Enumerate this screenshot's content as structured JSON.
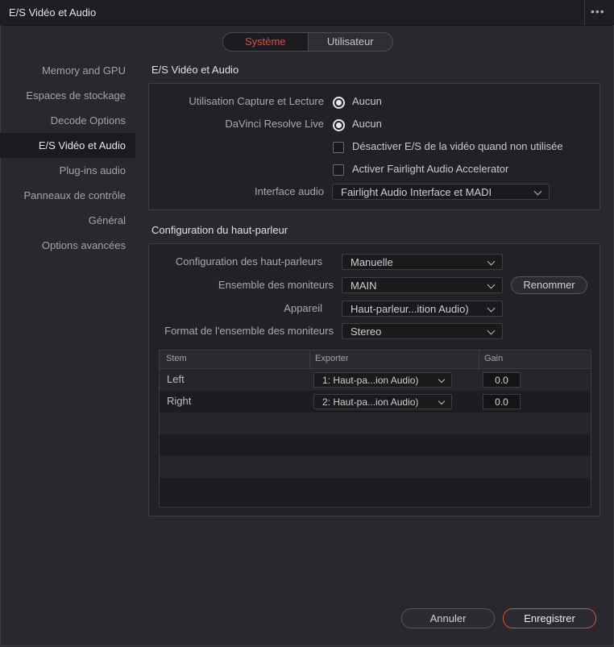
{
  "window": {
    "title": "E/S Vidéo et Audio",
    "menu_icon": "more-horizontal-icon"
  },
  "tabs": [
    {
      "label": "Système",
      "active": true
    },
    {
      "label": "Utilisateur",
      "active": false
    }
  ],
  "sidebar": {
    "items": [
      {
        "label": "Memory and GPU"
      },
      {
        "label": "Espaces de stockage"
      },
      {
        "label": "Decode Options"
      },
      {
        "label": "E/S Vidéo et Audio",
        "active": true
      },
      {
        "label": "Plug-ins audio"
      },
      {
        "label": "Panneaux de contrôle"
      },
      {
        "label": "Général"
      },
      {
        "label": "Options avancées"
      }
    ]
  },
  "io_section": {
    "title": "E/S Vidéo et Audio",
    "capture_label": "Utilisation Capture et Lecture",
    "capture_value": "Aucun",
    "live_label": "DaVinci Resolve Live",
    "live_value": "Aucun",
    "disable_io_label": "Désactiver E/S de la vidéo quand non utilisée",
    "fairlight_accel_label": "Activer Fairlight Audio Accelerator",
    "interface_label": "Interface audio",
    "interface_value": "Fairlight Audio Interface et MADI"
  },
  "speaker_section": {
    "title": "Configuration du haut-parleur",
    "config_label": "Configuration des haut-parleurs",
    "config_value": "Manuelle",
    "monitor_set_label": "Ensemble des moniteurs",
    "monitor_set_value": "MAIN",
    "rename_button": "Renommer",
    "device_label": "Appareil",
    "device_value": "Haut-parleur...ition Audio)",
    "format_label": "Format de l'ensemble des moniteurs",
    "format_value": "Stereo"
  },
  "table": {
    "headers": {
      "stem": "Stem",
      "export": "Exporter",
      "gain": "Gain"
    },
    "rows": [
      {
        "stem": "Left",
        "export": "1: Haut-pa...ion Audio)",
        "gain": "0.0"
      },
      {
        "stem": "Right",
        "export": "2: Haut-pa...ion Audio)",
        "gain": "0.0"
      }
    ]
  },
  "footer": {
    "cancel": "Annuler",
    "save": "Enregistrer"
  },
  "colors": {
    "accent": "#e24a3b",
    "background": "#28282e",
    "panel": "#222226"
  }
}
